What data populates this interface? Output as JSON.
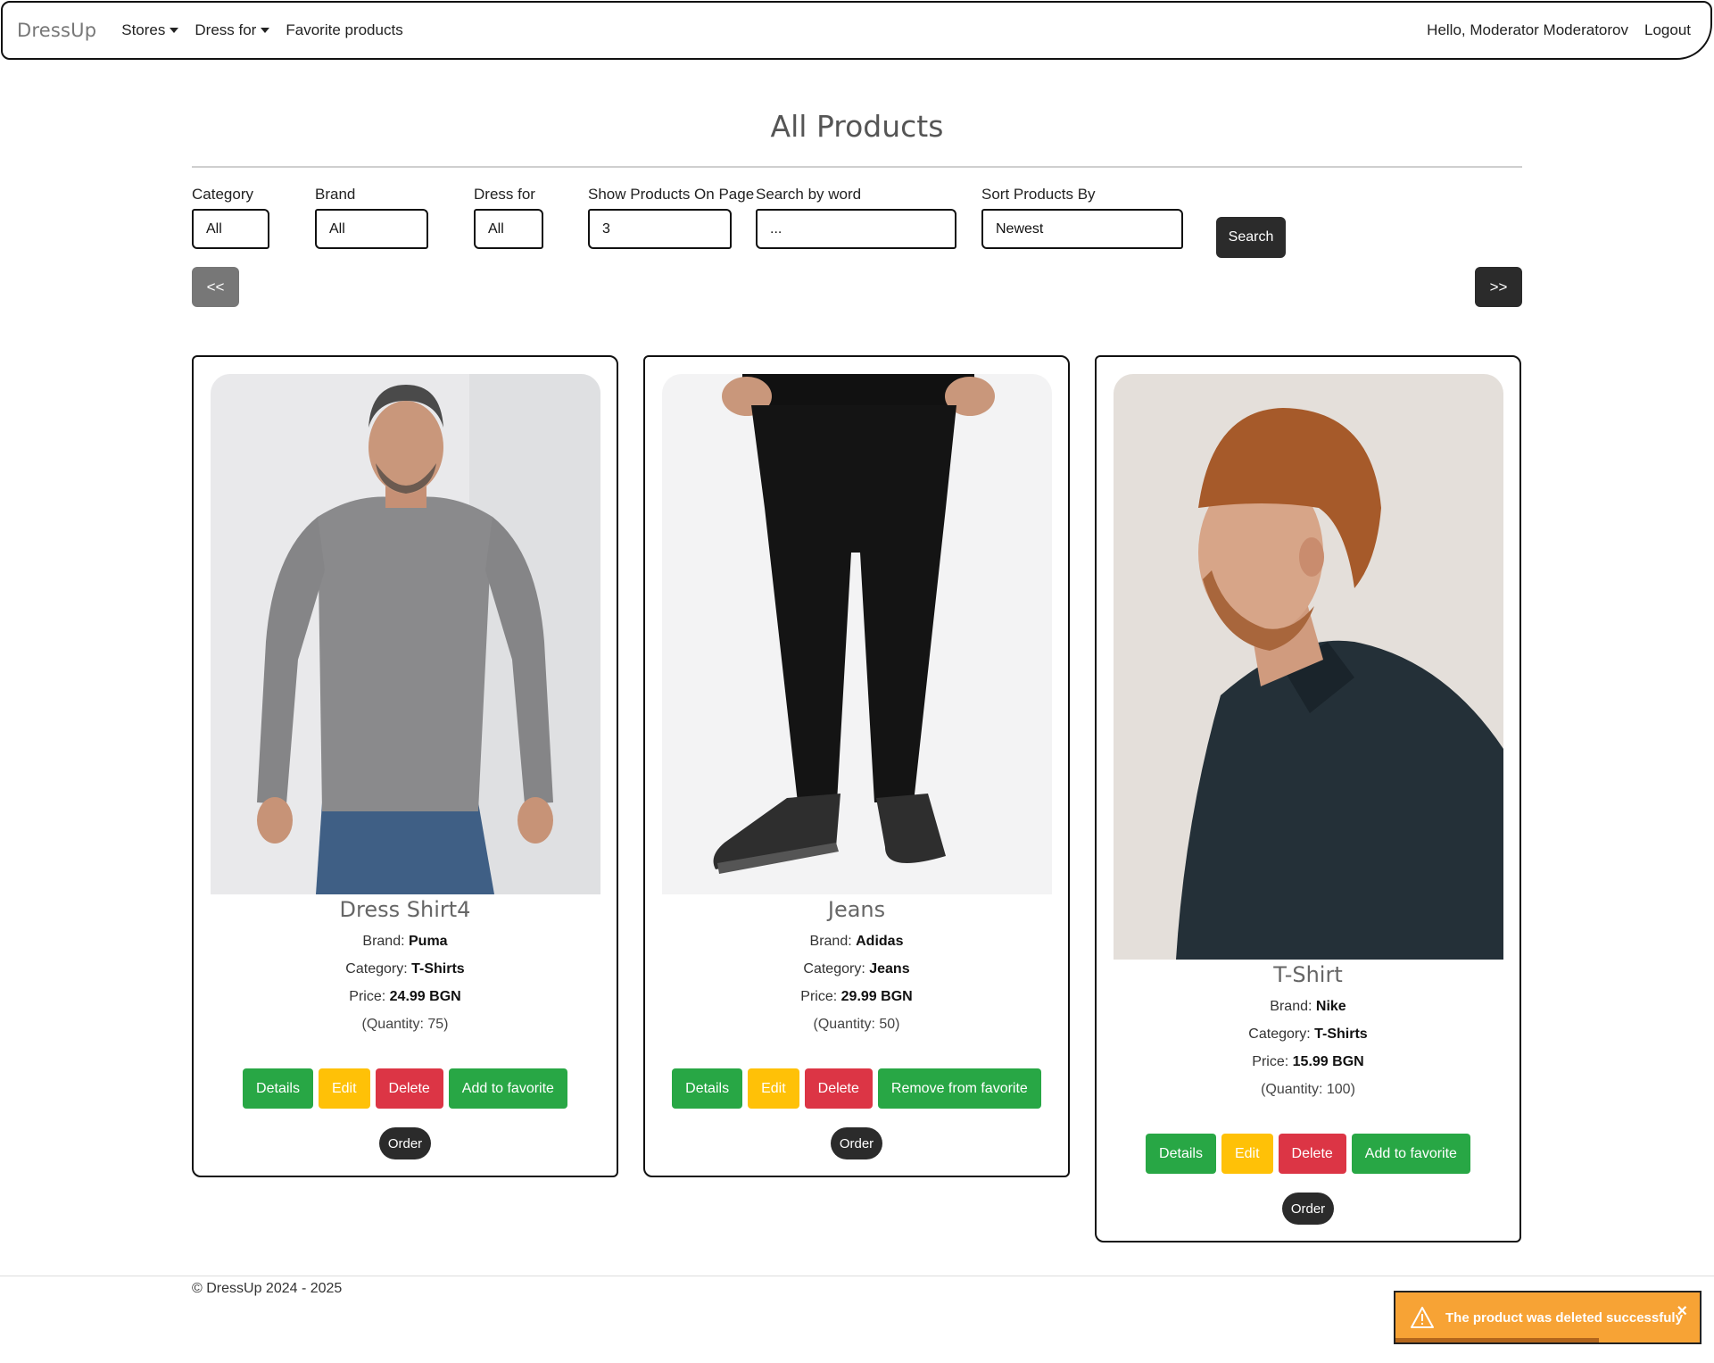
{
  "navbar": {
    "brand": "DressUp",
    "links": [
      "Stores",
      "Dress for",
      "Favorite products"
    ],
    "greeting": "Hello, Moderator Moderatorov",
    "logout": "Logout"
  },
  "page": {
    "title": "All Products"
  },
  "filters": {
    "category": {
      "label": "Category",
      "value": "All"
    },
    "brand": {
      "label": "Brand",
      "value": "All"
    },
    "dress_for": {
      "label": "Dress for",
      "value": "All"
    },
    "per_page": {
      "label": "Show Products On Page",
      "value": "3"
    },
    "search": {
      "label": "Search by word",
      "value": "..."
    },
    "sort": {
      "label": "Sort Products By",
      "value": "Newest"
    },
    "search_button": "Search"
  },
  "pagination": {
    "prev": "<<",
    "next": ">>"
  },
  "labels": {
    "brand": "Brand:",
    "category": "Category:",
    "price": "Price:",
    "details": "Details",
    "edit": "Edit",
    "delete": "Delete",
    "order": "Order"
  },
  "products": [
    {
      "title": "Dress Shirt4",
      "brand": "Puma",
      "category": "T-Shirts",
      "price": "24.99 BGN",
      "quantity": "(Quantity: 75)",
      "favorite_label": "Add to favorite"
    },
    {
      "title": "Jeans",
      "brand": "Adidas",
      "category": "Jeans",
      "price": "29.99 BGN",
      "quantity": "(Quantity: 50)",
      "favorite_label": "Remove from favorite"
    },
    {
      "title": "T-Shirt",
      "brand": "Nike",
      "category": "T-Shirts",
      "price": "15.99 BGN",
      "quantity": "(Quantity: 100)",
      "favorite_label": "Add to favorite"
    }
  ],
  "footer": {
    "text": "© DressUp 2024 - 2025"
  },
  "toast": {
    "message": "The product was deleted successfuly",
    "close": "×"
  }
}
